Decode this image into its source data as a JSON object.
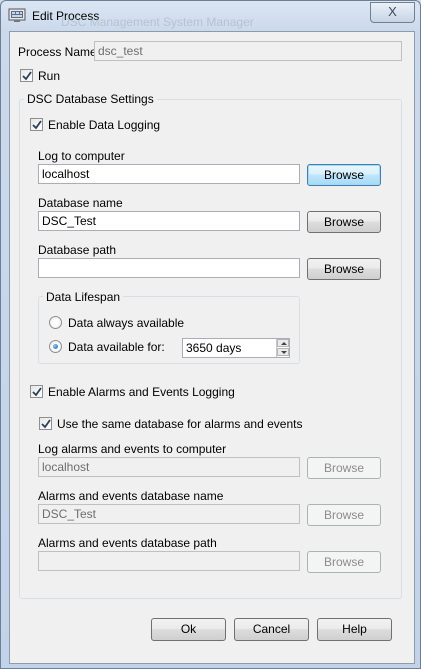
{
  "window": {
    "title": "Edit Process",
    "background_title": "DSC Management System Manager",
    "close_symbol": "X"
  },
  "process_name": {
    "label": "Process Name:",
    "value": "dsc_test"
  },
  "run": {
    "label": "Run",
    "checked": true
  },
  "dsc_settings": {
    "group_title": "DSC Database Settings",
    "enable_data_logging": {
      "label": "Enable Data Logging",
      "checked": true
    },
    "log_to_computer": {
      "label": "Log to computer",
      "value": "localhost",
      "browse": "Browse"
    },
    "database_name": {
      "label": "Database name",
      "value": "DSC_Test",
      "browse": "Browse"
    },
    "database_path": {
      "label": "Database path",
      "value": "",
      "browse": "Browse"
    },
    "lifespan": {
      "group_title": "Data Lifespan",
      "always_label": "Data always available",
      "available_for_label": "Data available for:",
      "days_value": "3650 days",
      "selected": "available_for"
    },
    "enable_alarms": {
      "label": "Enable Alarms and Events Logging",
      "checked": true
    },
    "same_database": {
      "label": "Use the same database for alarms and events",
      "checked": true
    },
    "alarms_computer": {
      "label": "Log alarms and events to computer",
      "value": "localhost",
      "browse": "Browse"
    },
    "alarms_db_name": {
      "label": "Alarms and events database name",
      "value": "DSC_Test",
      "browse": "Browse"
    },
    "alarms_db_path": {
      "label": "Alarms and events database path",
      "value": "",
      "browse": "Browse"
    }
  },
  "footer": {
    "ok": "Ok",
    "cancel": "Cancel",
    "help": "Help"
  },
  "colors": {
    "focus_button": "#bee6fd",
    "window_frame": "#cbd9eb",
    "dialog_bg": "#f0f0f0"
  }
}
